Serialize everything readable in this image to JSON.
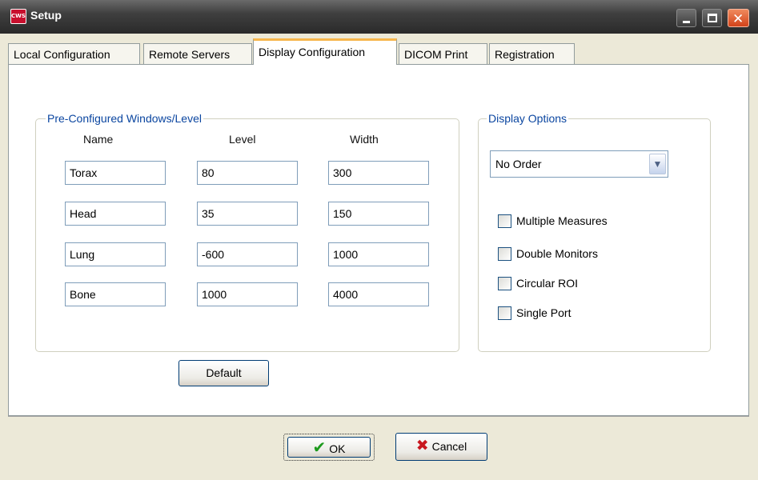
{
  "window": {
    "title": "Setup",
    "app_icon_text": "CWS"
  },
  "tabs": [
    {
      "label": "Local Configuration"
    },
    {
      "label": "Remote Servers"
    },
    {
      "label": "Display Configuration"
    },
    {
      "label": "DICOM Print"
    },
    {
      "label": "Registration"
    }
  ],
  "active_tab": "Display Configuration",
  "preconfigured": {
    "legend": "Pre-Configured Windows/Level",
    "headers": {
      "name": "Name",
      "level": "Level",
      "width": "Width"
    },
    "rows": [
      {
        "name": "Torax",
        "level": "80",
        "width": "300"
      },
      {
        "name": "Head",
        "level": "35",
        "width": "150"
      },
      {
        "name": "Lung",
        "level": "-600",
        "width": "1000"
      },
      {
        "name": "Bone",
        "level": "1000",
        "width": "4000"
      }
    ],
    "default_button": "Default"
  },
  "display_options": {
    "legend": "Display Options",
    "order_select": {
      "value": "No Order"
    },
    "checkboxes": [
      {
        "label": "Multiple Measures",
        "checked": false
      },
      {
        "label": "Double Monitors",
        "checked": false
      },
      {
        "label": "Circular ROI",
        "checked": false
      },
      {
        "label": "Single Port",
        "checked": false
      }
    ]
  },
  "footer": {
    "ok_label": "OK",
    "cancel_label": "Cancel"
  },
  "icons": {
    "app": "app-logo-icon",
    "minimize": "minimize-icon",
    "maximize": "maximize-icon",
    "close": "close-icon",
    "ok": "check-icon",
    "cancel": "x-icon",
    "dropdown": "chevron-down-icon"
  },
  "colors": {
    "legend_text": "#0b46a0",
    "active_tab_accent": "#f7b64c",
    "close_button": "#d2431a"
  }
}
